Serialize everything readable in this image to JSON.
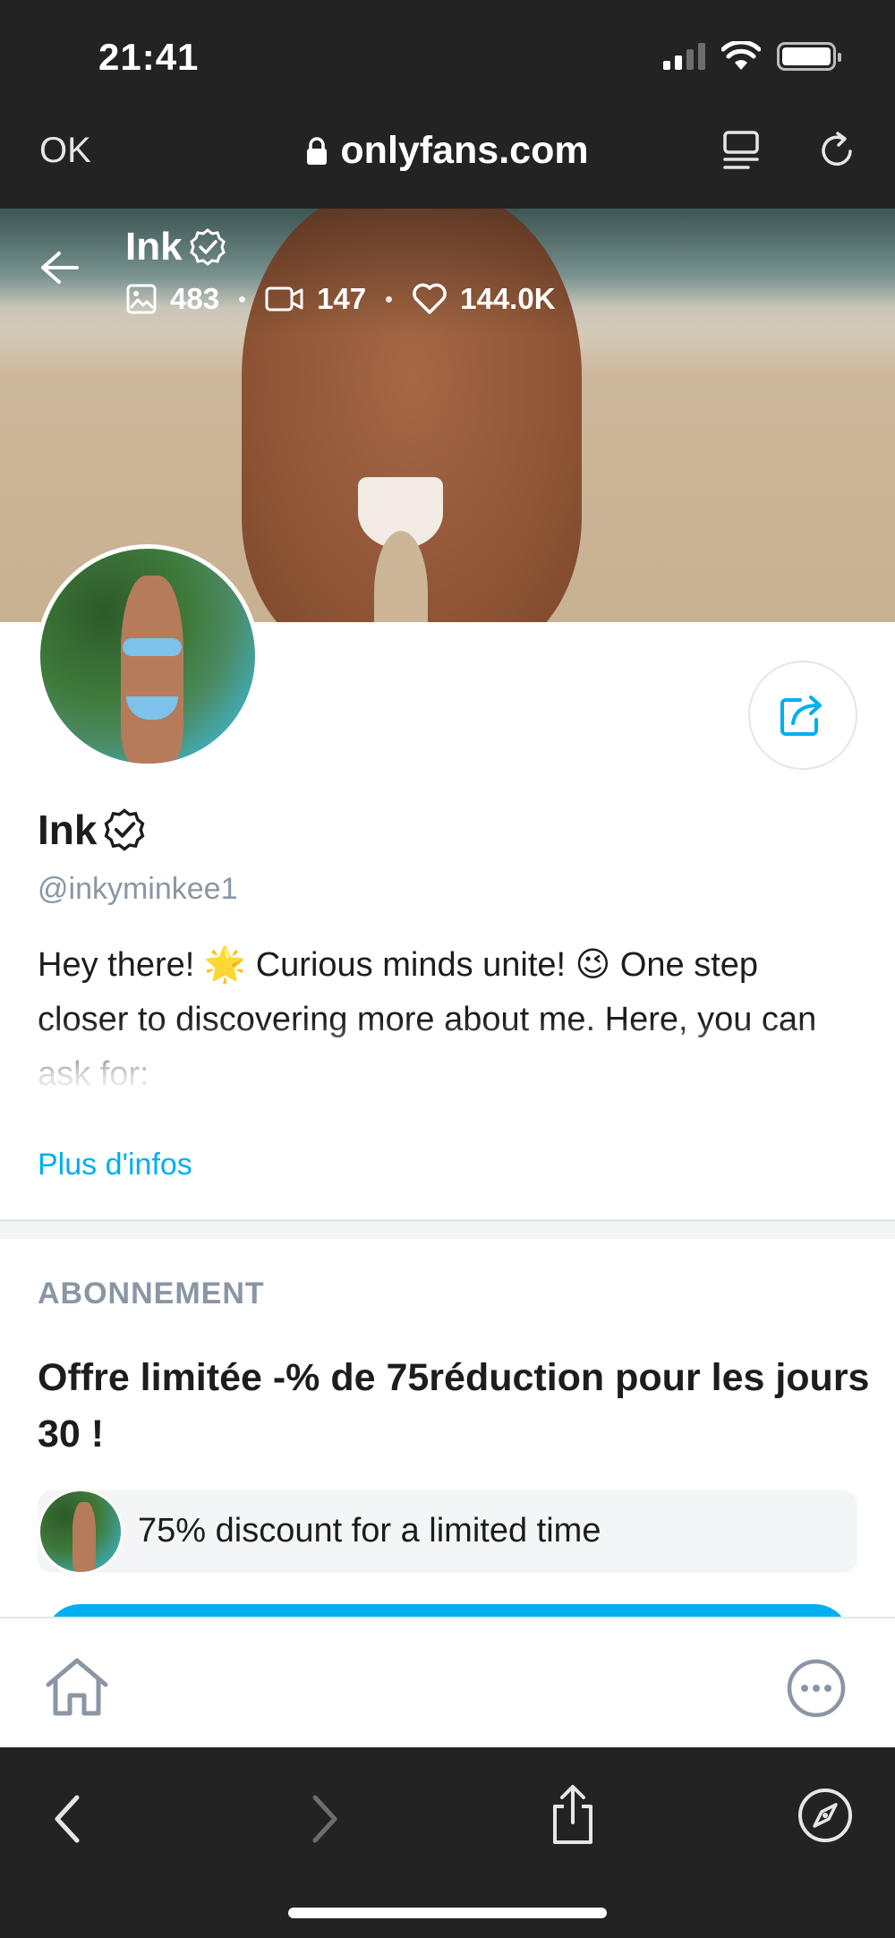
{
  "status_bar": {
    "time": "21:41"
  },
  "browser": {
    "ok_label": "OK",
    "url": "onlyfans.com"
  },
  "cover": {
    "name": "Ink",
    "stats": {
      "photos": "483",
      "videos": "147",
      "likes": "144.0K"
    }
  },
  "profile": {
    "name": "Ink",
    "handle": "@inkyminkee1",
    "bio": "Hey there! 🌟 Curious minds unite! 😉 One step closer to discovering more about me. Here, you can ask for:",
    "more_link": "Plus d'infos"
  },
  "subscription": {
    "label": "ABONNEMENT",
    "offer_title": "Offre limitée -% de 75réduction pour les jours 30 !",
    "promo_text": "75% discount for a limited time"
  },
  "colors": {
    "accent": "#00aff0",
    "muted": "#8a96a3",
    "chrome": "#232323"
  }
}
